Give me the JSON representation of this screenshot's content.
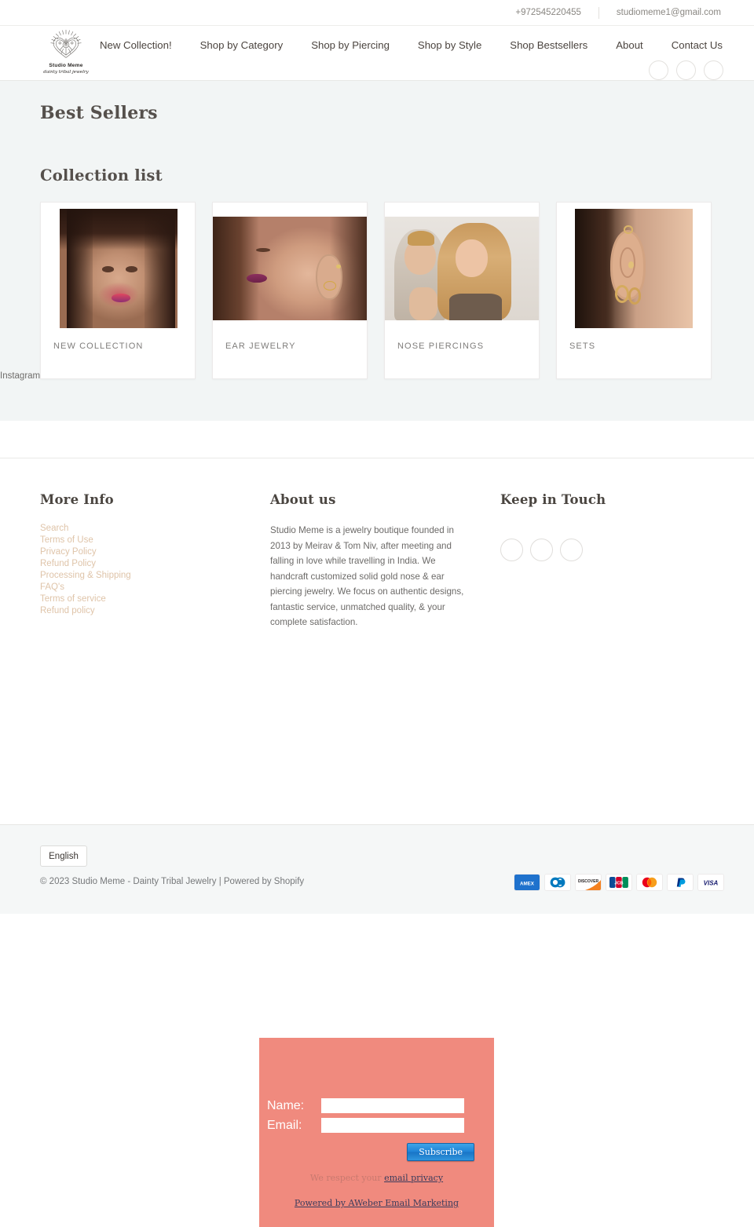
{
  "topbar": {
    "phone": "+972545220455",
    "email": "studiomeme1@gmail.com"
  },
  "brand": {
    "name": "Studio Meme",
    "tagline": "dainty tribal jewelry",
    "logo_icon": "tribal-mandala-logo"
  },
  "nav": {
    "items": [
      {
        "label": "New Collection!"
      },
      {
        "label": "Shop by Category"
      },
      {
        "label": "Shop by Piercing"
      },
      {
        "label": "Shop by Style"
      },
      {
        "label": "Shop Bestsellers"
      },
      {
        "label": "About"
      },
      {
        "label": "Contact Us"
      }
    ],
    "social": [
      {
        "icon": "facebook-circle-icon"
      },
      {
        "icon": "instagram-circle-icon"
      },
      {
        "icon": "pinterest-circle-icon"
      }
    ]
  },
  "main": {
    "page_title": "Best Sellers",
    "section_title": "Collection list",
    "instagram_label": "Instagram",
    "collections": [
      {
        "label": "NEW COLLECTION",
        "image_alt": "woman with nose ring and pink lipstick"
      },
      {
        "label": "EAR JEWELRY",
        "image_alt": "profile of woman with gold ear piercings"
      },
      {
        "label": "NOSE PIERCINGS",
        "image_alt": "two people with nose piercings"
      },
      {
        "label": "SETS",
        "image_alt": "ear with multiple gold hoop earrings"
      }
    ]
  },
  "footer": {
    "more_info": {
      "title": "More Info",
      "links": [
        {
          "label": "Search"
        },
        {
          "label": "Terms of Use"
        },
        {
          "label": "Privacy Policy"
        },
        {
          "label": "Refund Policy"
        },
        {
          "label": "Processing & Shipping"
        },
        {
          "label": "FAQ's"
        },
        {
          "label": "Terms of service"
        },
        {
          "label": "Refund policy"
        }
      ]
    },
    "about": {
      "title": "About us",
      "text": "Studio Meme is a jewelry boutique founded in 2013 by Meirav & Tom Niv, after meeting and falling in love while travelling in India. We handcraft customized solid gold nose & ear piercing jewelry. We focus on authentic designs, fantastic service, unmatched quality, & your complete satisfaction."
    },
    "keep_in_touch": {
      "title": "Keep in Touch",
      "social": [
        {
          "icon": "facebook-circle-icon"
        },
        {
          "icon": "instagram-circle-icon"
        },
        {
          "icon": "pinterest-circle-icon"
        }
      ]
    }
  },
  "newsletter": {
    "name_label": "Name:",
    "email_label": "Email:",
    "name_value": "",
    "email_value": "",
    "submit_label": "Subscribe",
    "privacy_prefix": "We respect your ",
    "privacy_link": "email privacy",
    "powered_by": "Powered by AWeber Email Marketing",
    "background_color": "#f08a7e",
    "button_color": "#1e82d6"
  },
  "bottombar": {
    "language": "English",
    "copyright": "© 2023 Studio Meme - Dainty Tribal Jewelry  |  Powered by Shopify",
    "payment_methods": [
      {
        "name": "amex",
        "label": "AMEX"
      },
      {
        "name": "diners-club",
        "label": ""
      },
      {
        "name": "discover",
        "label": "DISCOVER"
      },
      {
        "name": "jcb",
        "label": "JCB"
      },
      {
        "name": "mastercard",
        "label": ""
      },
      {
        "name": "paypal",
        "label": "P"
      },
      {
        "name": "visa",
        "label": "VISA"
      }
    ]
  }
}
